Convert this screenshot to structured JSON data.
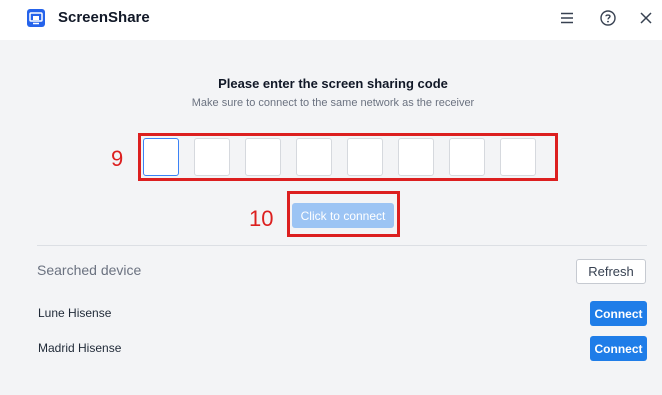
{
  "app": {
    "title": "ScreenShare",
    "icon": "screenshare-logo-icon"
  },
  "titlebar": {
    "menu_icon": "menu-icon",
    "help_icon": "help-icon",
    "close_icon": "close-icon"
  },
  "code_entry": {
    "heading": "Please enter the screen sharing code",
    "subheading": "Make sure to connect to the same network as the receiver",
    "digits": [
      "",
      "",
      "",
      "",
      "",
      "",
      "",
      ""
    ],
    "connect_label": "Click to connect"
  },
  "annotations": {
    "code_label": "9",
    "connect_label": "10",
    "color": "#dc1f1f"
  },
  "devices": {
    "section_label": "Searched device",
    "refresh_label": "Refresh",
    "items": [
      {
        "name": "Lune Hisense",
        "action": "Connect"
      },
      {
        "name": "Madrid Hisense",
        "action": "Connect"
      }
    ]
  },
  "colors": {
    "accent": "#1f7de8",
    "accent_disabled": "#9cc4f4",
    "background": "#f3f4f6"
  }
}
